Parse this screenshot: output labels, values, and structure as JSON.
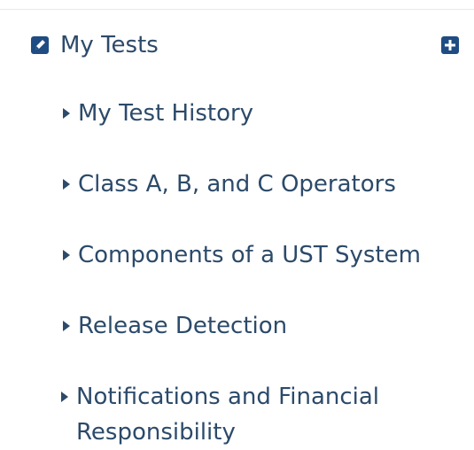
{
  "nav": {
    "title": "My Tests",
    "items": [
      {
        "label": "My Test History"
      },
      {
        "label": "Class A, B, and C Operators"
      },
      {
        "label": "Components of a UST System"
      },
      {
        "label": "Release Detection"
      },
      {
        "label": "Notifications and Financial Responsibility"
      }
    ]
  },
  "icons": {
    "edit": "edit-icon",
    "plus": "plus-icon",
    "caret": "caret-right-icon"
  },
  "colors": {
    "text": "#2c4a6a",
    "icon": "#1f4c82"
  }
}
